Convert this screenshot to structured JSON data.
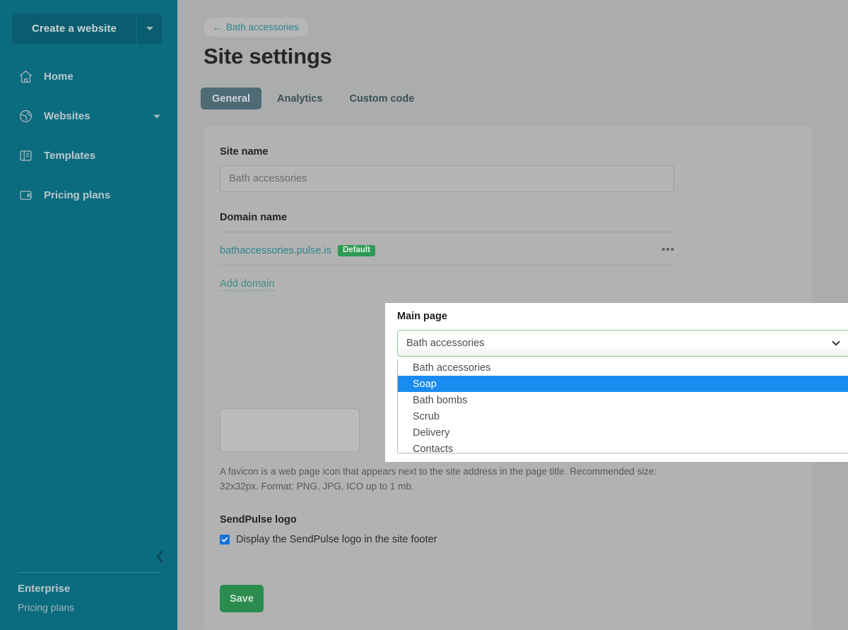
{
  "sidebar": {
    "create_button": {
      "label": "Create a website",
      "icon": "caret-down-icon"
    },
    "items": [
      {
        "label": "Home",
        "icon": "home-icon",
        "has_caret": false
      },
      {
        "label": "Websites",
        "icon": "globe-icon",
        "has_caret": true
      },
      {
        "label": "Templates",
        "icon": "template-icon",
        "has_caret": false
      },
      {
        "label": "Pricing plans",
        "icon": "wallet-icon",
        "has_caret": false
      }
    ],
    "collapse_icon": "chevron-left-icon",
    "plan_name": "Enterprise",
    "plan_link": "Pricing plans"
  },
  "header": {
    "back_arrow": "←",
    "back_label": "Bath accessories",
    "title": "Site settings",
    "tabs": [
      {
        "label": "General",
        "active": true
      },
      {
        "label": "Analytics",
        "active": false
      },
      {
        "label": "Custom code",
        "active": false
      }
    ]
  },
  "form": {
    "site_name": {
      "label": "Site name",
      "value": "",
      "placeholder": "Bath accessories"
    },
    "domain": {
      "label": "Domain name",
      "name": "bathaccessories.pulse.is",
      "badge": "Default",
      "menu_icon": "ellipsis-icon",
      "add_link": "Add domain"
    },
    "favicon": {
      "hint": "A favicon is a web page icon that appears next to the site address in the page title. Recommended size: 32x32px. Format: PNG, JPG, ICO up to 1 mb."
    },
    "sendpulse": {
      "label": "SendPulse logo",
      "checkbox_label": "Display the SendPulse logo in the site footer",
      "checked": true
    },
    "save_label": "Save"
  },
  "dropdown": {
    "label": "Main page",
    "selected_value": "Bath accessories",
    "chevron_icon": "chevron-down-icon",
    "options": [
      {
        "label": "Bath accessories",
        "highlighted": false
      },
      {
        "label": "Soap",
        "highlighted": true
      },
      {
        "label": "Bath bombs",
        "highlighted": false
      },
      {
        "label": "Scrub",
        "highlighted": false
      },
      {
        "label": "Delivery",
        "highlighted": false
      },
      {
        "label": "Contacts",
        "highlighted": false
      }
    ]
  },
  "colors": {
    "sidebar_bg": "#0b6b7f",
    "page_bg": "#abadac",
    "card_bg": "#b2b2b2",
    "accent_teal": "#2f8490",
    "accent_green": "#2a8d4e",
    "badge_green": "#2d9a53",
    "highlight_blue": "#1a8bf0",
    "checkbox_blue": "#1673d8",
    "select_border_green": "#83ce96",
    "dropzone_green": "#29a05e"
  }
}
